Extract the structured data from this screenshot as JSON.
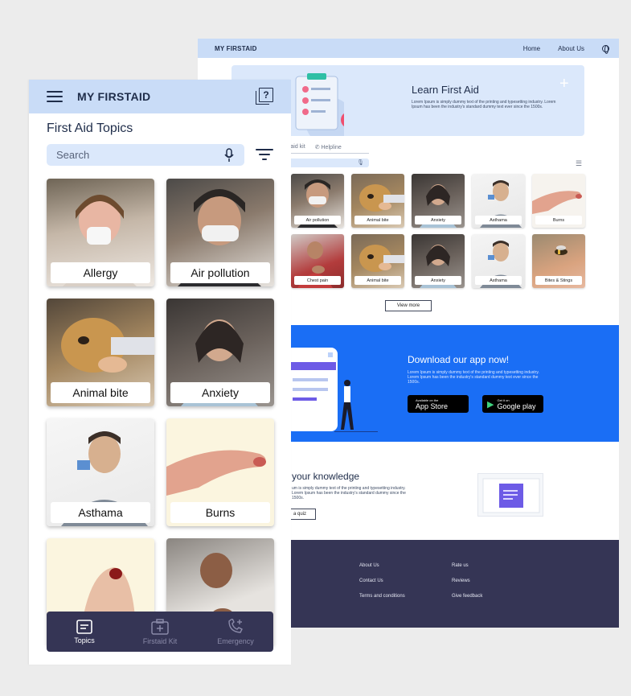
{
  "desktop": {
    "nav": {
      "logo": "MY FIRSTAID",
      "links": [
        "Home",
        "About Us"
      ]
    },
    "hero": {
      "title": "Learn First Aid",
      "text": "Lorem Ipsum is simply dummy text of the printing and typesetting industry. Lorem Ipsum has been the industry's standard dummy text ever since the 1500s."
    },
    "tabs": [
      "st aid kit",
      "Helpline"
    ],
    "cards": [
      "Air pollution",
      "Animal bite",
      "Anxiety",
      "Asthama",
      "Burns",
      "Chest pain",
      "Animal bite",
      "Anxiety",
      "Asthama",
      "Bites & Stings"
    ],
    "view_more": "View more",
    "download": {
      "title": "Download our app now!",
      "text": "Lorem Ipsum is simply dummy text of the printing and typesetting industry. Lorem Ipsum has been the industry's standard dummy text ever since the 1500s.",
      "appstore_small": "Available on the",
      "appstore_big": "App Store",
      "googleplay_small": "Get it on",
      "googleplay_big": "Google play"
    },
    "quiz": {
      "title": "your knowledge",
      "text": "um is simply dummy text of the printing and typesetting industry. Lorem Ipsum has been the industry's standard dummy since the 1500s.",
      "button": "a quiz"
    },
    "footer": {
      "col1": [
        "About Us",
        "Contact Us",
        "Terms and conditions"
      ],
      "col2": [
        "Rate us",
        "Reviews",
        "Give feedback"
      ]
    }
  },
  "mobile": {
    "header": {
      "logo": "MY FIRSTAID"
    },
    "title": "First Aid Topics",
    "search": {
      "placeholder": "Search"
    },
    "cards": [
      "Allergy",
      "Air pollution",
      "Animal bite",
      "Anxiety",
      "Asthama",
      "Burns",
      "",
      ""
    ],
    "bottom_nav": [
      {
        "label": "Topics",
        "icon": "topics-icon",
        "active": true
      },
      {
        "label": "Firstaid Kit",
        "icon": "firstaid-kit-icon",
        "active": false
      },
      {
        "label": "Emergency",
        "icon": "emergency-phone-icon",
        "active": false
      }
    ]
  },
  "colors": {
    "header_blue": "#c9dcf7",
    "light_blue": "#dbe8fb",
    "download_blue": "#1a6ef5",
    "footer_navy": "#353555",
    "text_navy": "#1f2d4a",
    "inactive_nav": "#8a8aa8"
  }
}
